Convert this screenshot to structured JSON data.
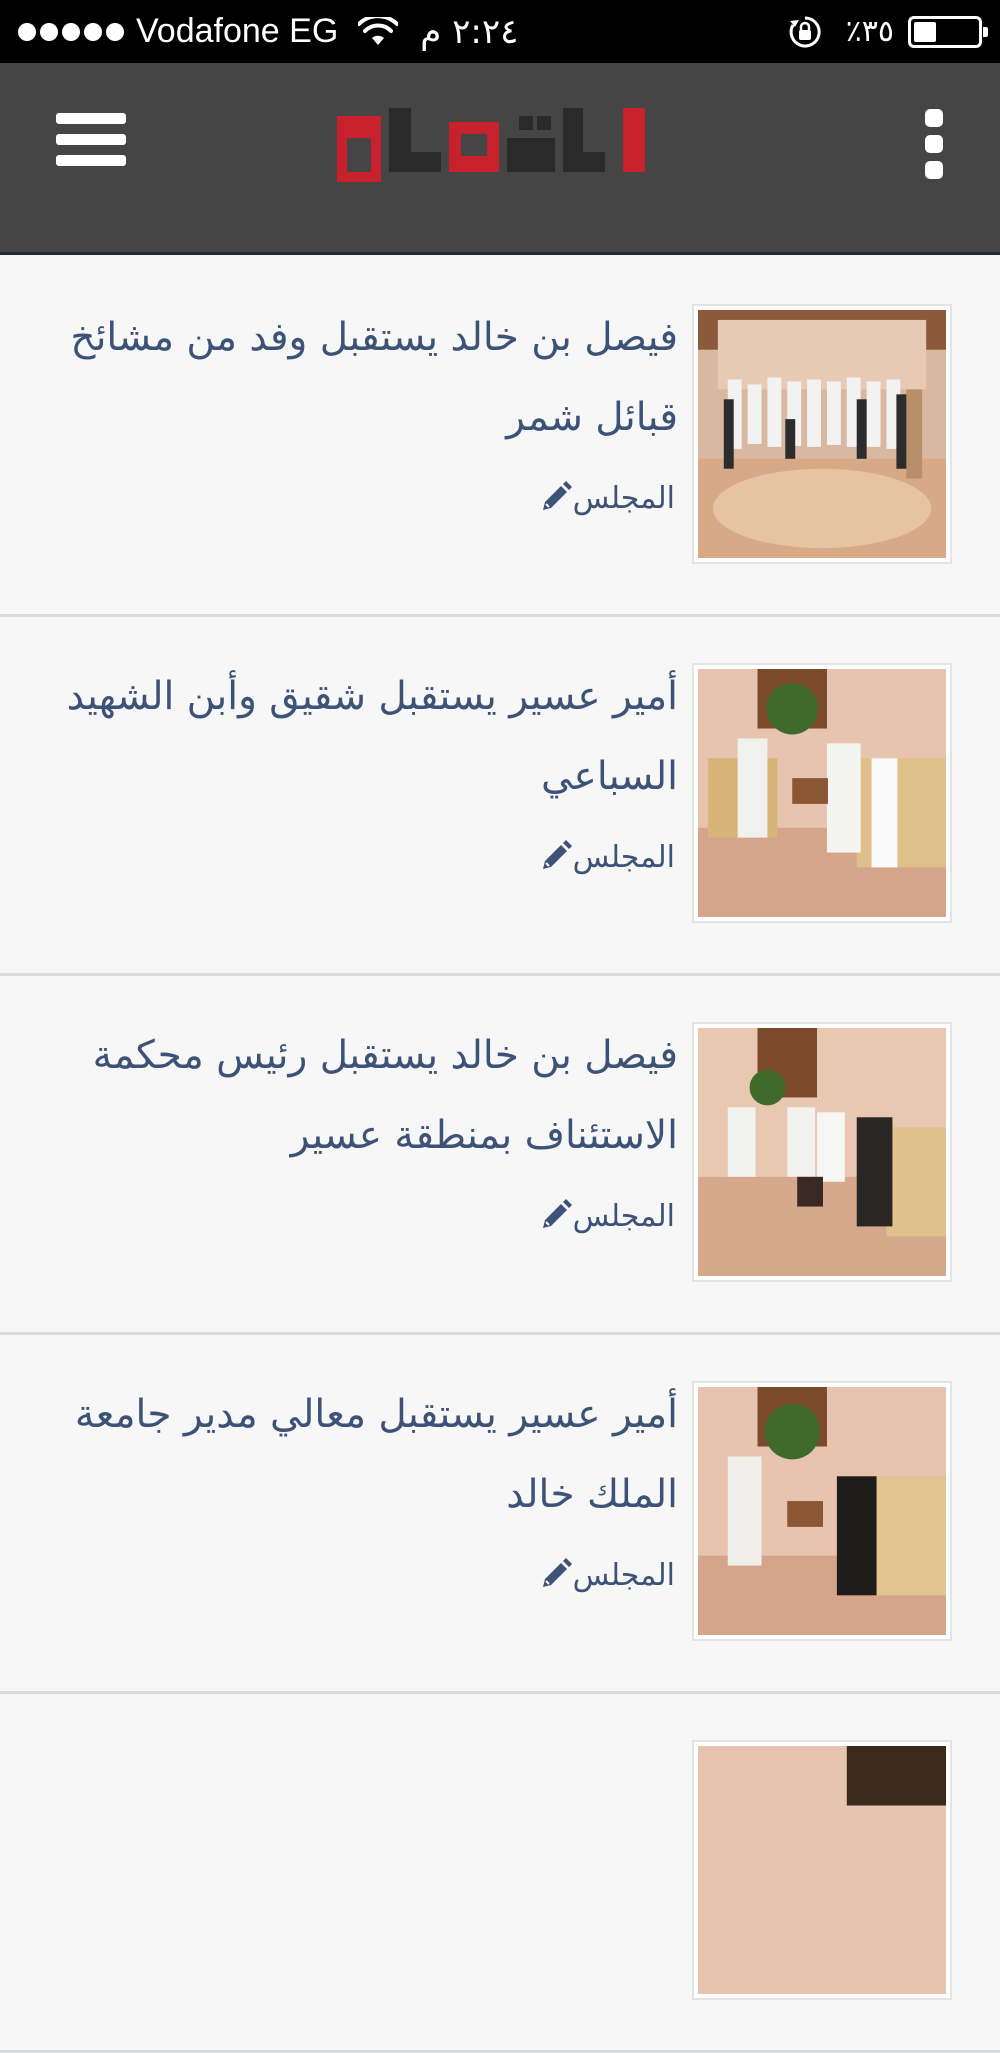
{
  "status_bar": {
    "carrier": "Vodafone EG",
    "time": "٢:٢٤ م",
    "battery_percent_text": "٪٣٥",
    "battery_level": 0.35,
    "icons": [
      "signal-dots",
      "wifi-icon",
      "rotation-lock-icon",
      "battery-icon"
    ]
  },
  "app_bar": {
    "logo_text": "الديوان",
    "colors": {
      "background": "#454545",
      "logo_red": "#c8202d",
      "logo_dark": "#2a2a2a"
    },
    "icons": [
      "menu-icon",
      "more-vert-icon"
    ]
  },
  "articles": [
    {
      "title": "فيصل بن خالد يستقبل وفد من مشائخ قبائل شمر",
      "category": "المجلس"
    },
    {
      "title": "أمير عسير يستقبل شقيق وأبن الشهيد السباعي",
      "category": "المجلس"
    },
    {
      "title": "فيصل بن خالد يستقبل رئيس محكمة الاستئناف بمنطقة عسير",
      "category": "المجلس"
    },
    {
      "title": "أمير عسير يستقبل معالي مدير جامعة الملك خالد",
      "category": "المجلس"
    },
    {
      "title": "",
      "category": ""
    }
  ],
  "colors": {
    "headline": "#3d5277",
    "divider": "#d8dcdf",
    "page_bg": "#f7f7f8"
  }
}
